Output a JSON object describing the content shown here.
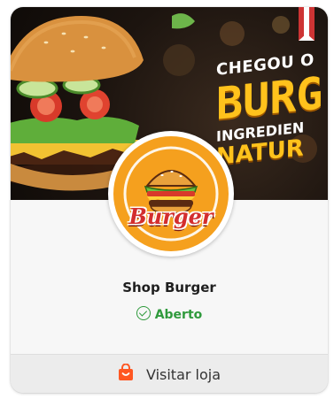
{
  "banner": {
    "line1": "CHEGOU O",
    "line2": "BURG",
    "line3": "INGREDIEN",
    "line4": "NATUR"
  },
  "logo": {
    "text": "Burger"
  },
  "shop": {
    "name": "Shop Burger"
  },
  "status": {
    "label": "Aberto",
    "color": "#2f9a3c"
  },
  "action": {
    "label": "Visitar loja",
    "icon": "shopping-bag-icon",
    "icon_color": "#ff5722"
  },
  "colors": {
    "accent": "#ffc21c",
    "logo_bg": "#f5a01e"
  }
}
